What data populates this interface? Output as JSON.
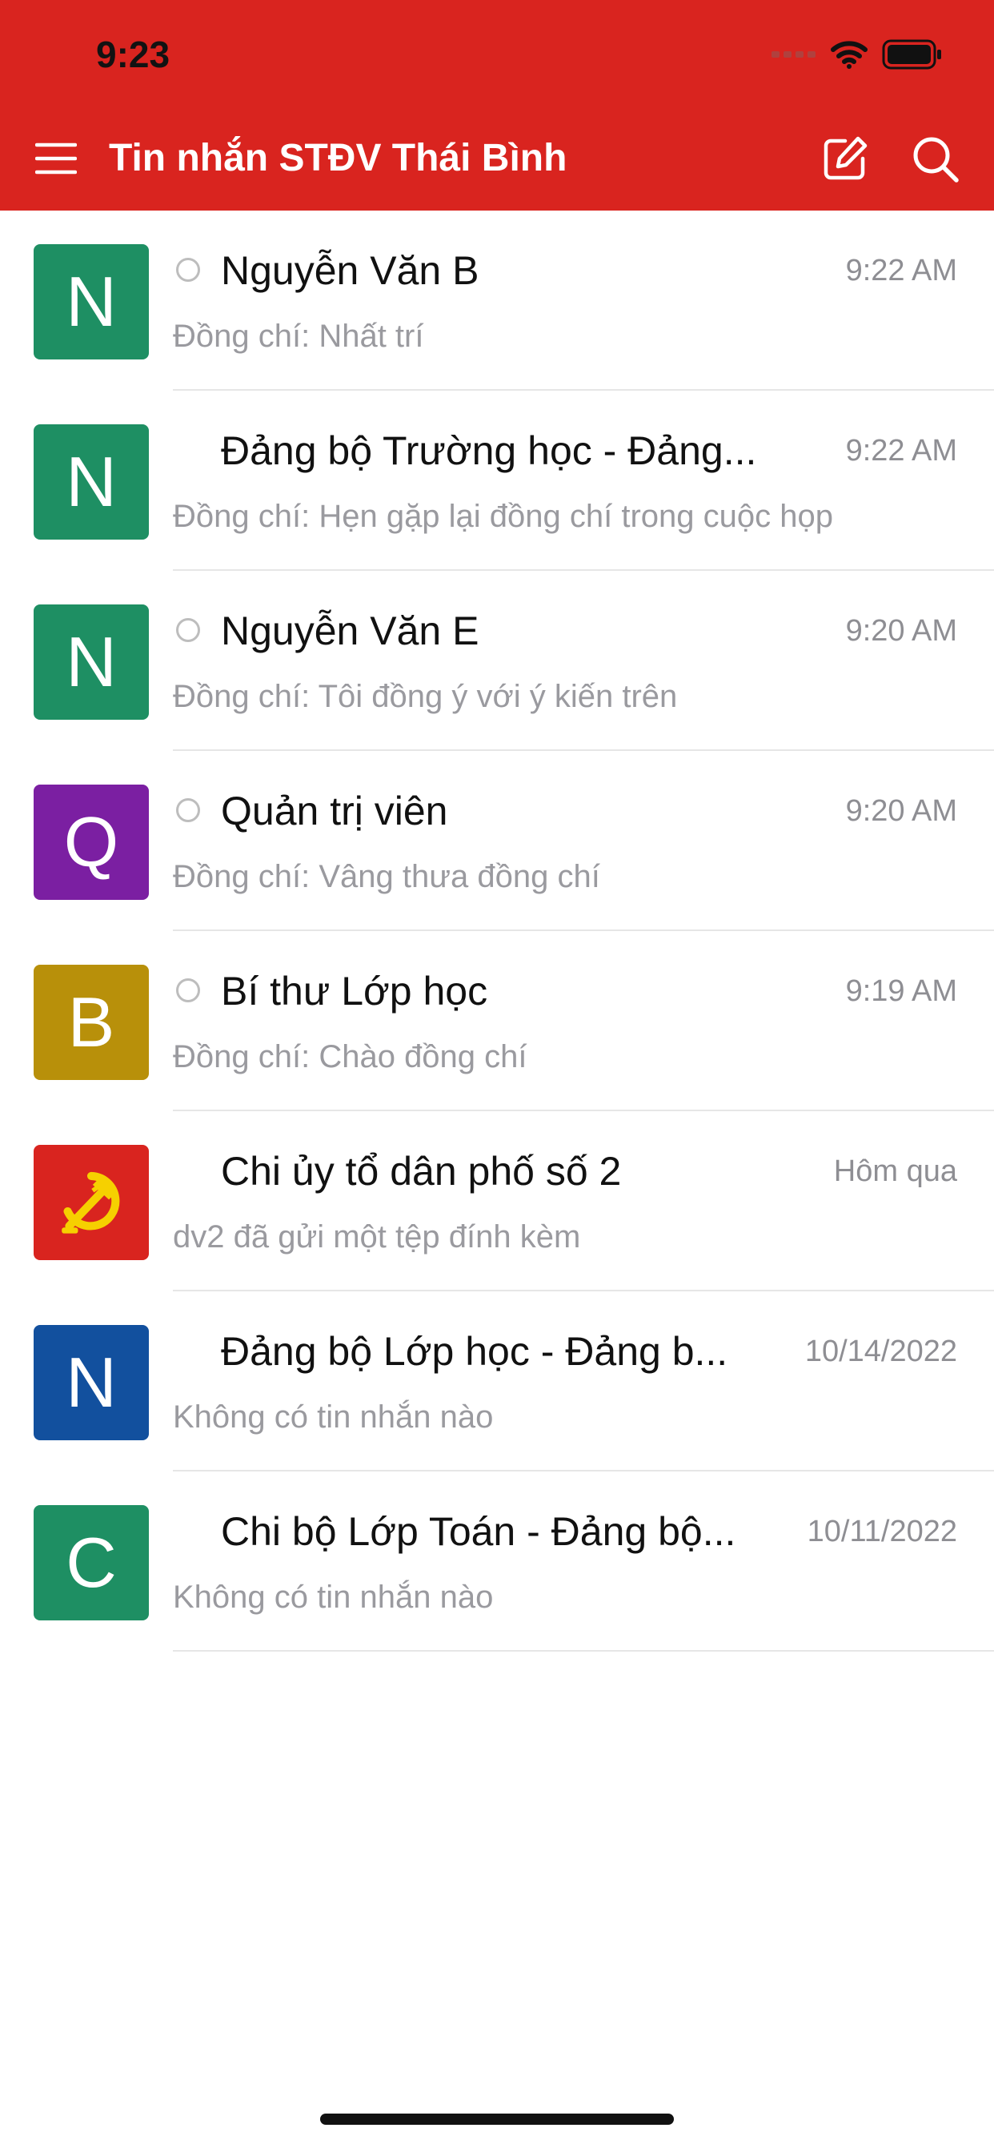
{
  "status_bar": {
    "time": "9:23"
  },
  "header": {
    "title": "Tin nhắn STĐV Thái Bình"
  },
  "colors": {
    "header": "#d9241f",
    "accent_green": "#1e8f63",
    "accent_purple": "#7b1fa2",
    "accent_gold": "#b8900a",
    "accent_red": "#d9241f",
    "accent_blue": "#12509e"
  },
  "conversations": [
    {
      "initial": "N",
      "avatar_color": "#1e8f63",
      "has_radio": true,
      "name": "Nguyễn Văn B",
      "time": "9:22 AM",
      "preview": "Đồng chí: Nhất trí"
    },
    {
      "initial": "N",
      "avatar_color": "#1e8f63",
      "has_radio": false,
      "name": "Đảng bộ Trường học - Đảng...",
      "time": "9:22 AM",
      "preview": "Đồng chí: Hẹn gặp lại đồng chí trong cuộc họp"
    },
    {
      "initial": "N",
      "avatar_color": "#1e8f63",
      "has_radio": true,
      "name": "Nguyễn Văn E",
      "time": "9:20 AM",
      "preview": "Đồng chí: Tôi đồng ý với ý kiến trên"
    },
    {
      "initial": "Q",
      "avatar_color": "#7b1fa2",
      "has_radio": true,
      "name": "Quản trị viên",
      "time": "9:20 AM",
      "preview": "Đồng chí: Vâng thưa đồng chí"
    },
    {
      "initial": "B",
      "avatar_color": "#b8900a",
      "has_radio": true,
      "name": "Bí thư Lớp học",
      "time": "9:19 AM",
      "preview": "Đồng chí: Chào đồng chí"
    },
    {
      "initial": "",
      "avatar_icon": "hammer-sickle-icon",
      "avatar_color": "#d9241f",
      "has_radio": false,
      "name": "Chi ủy tổ dân phố số 2",
      "time": "Hôm qua",
      "preview": "dv2 đã gửi một tệp đính kèm"
    },
    {
      "initial": "N",
      "avatar_color": "#12509e",
      "has_radio": false,
      "name": "Đảng bộ Lớp học - Đảng b...",
      "time": "10/14/2022",
      "preview": "Không có tin nhắn nào"
    },
    {
      "initial": "C",
      "avatar_color": "#1e8f63",
      "has_radio": false,
      "name": "Chi bộ Lớp Toán - Đảng bộ...",
      "time": "10/11/2022",
      "preview": "Không có tin nhắn nào"
    }
  ]
}
